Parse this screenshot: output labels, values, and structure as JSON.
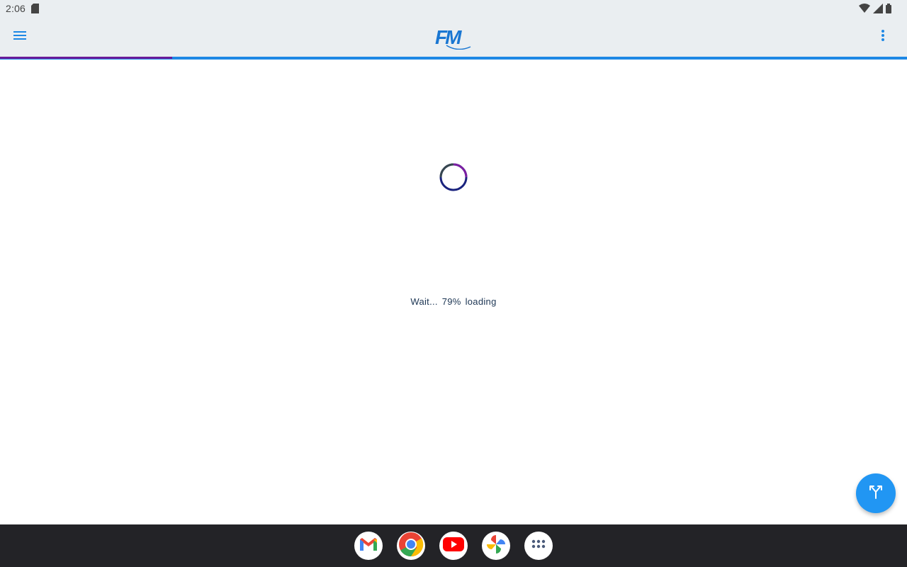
{
  "status_bar": {
    "time": "2:06",
    "icons": [
      "sd-card-icon",
      "wifi-icon",
      "signal-icon",
      "battery-icon"
    ]
  },
  "app_bar": {
    "logo_text": "FM",
    "menu_icon": "hamburger-menu-icon",
    "overflow_icon": "more-vert-icon"
  },
  "progress": {
    "value": 0.19,
    "fill_color": "#6a1b9a",
    "track_color": "#1e88e5"
  },
  "loading": {
    "text": "Wait... 79%  loading",
    "percent": 79
  },
  "fab": {
    "icon": "merge-icon",
    "color": "#2196f3"
  },
  "taskbar": {
    "apps": [
      {
        "name": "Gmail",
        "icon": "gmail-icon"
      },
      {
        "name": "Chrome",
        "icon": "chrome-icon"
      },
      {
        "name": "YouTube",
        "icon": "youtube-icon"
      },
      {
        "name": "Photos",
        "icon": "photos-icon"
      },
      {
        "name": "App drawer",
        "icon": "app-drawer-icon"
      }
    ]
  },
  "colors": {
    "app_bar_bg": "#eaeef1",
    "accent": "#1e88e5",
    "taskbar_bg": "#232327"
  }
}
